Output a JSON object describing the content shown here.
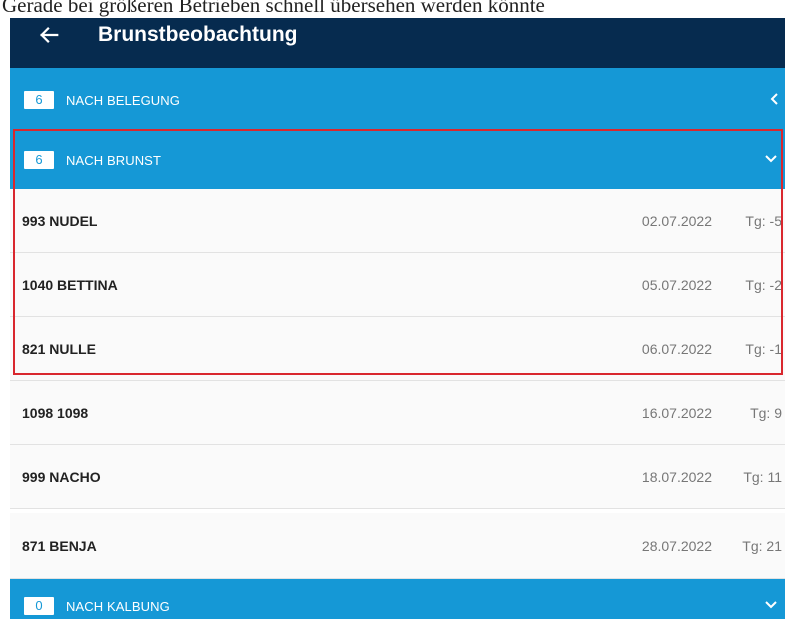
{
  "caption": "Gerade bei größeren Betrieben schnell übersehen werden könnte",
  "appbar": {
    "title": "Brunstbeobachtung",
    "back_icon": "arrow-left-icon"
  },
  "sections": [
    {
      "count": "6",
      "label": "NACH BELEGUNG",
      "chevron_icon": "chevron-left-icon"
    },
    {
      "count": "6",
      "label": "NACH BRUNST",
      "chevron_icon": "chevron-down-icon"
    },
    {
      "count": "0",
      "label": "NACH KALBUNG",
      "chevron_icon": "chevron-down-icon"
    }
  ],
  "rows": [
    {
      "name": "993 NUDEL",
      "date": "02.07.2022",
      "days": "Tg: -5"
    },
    {
      "name": "1040 BETTINA",
      "date": "05.07.2022",
      "days": "Tg: -2"
    },
    {
      "name": "821 NULLE",
      "date": "06.07.2022",
      "days": "Tg: -1"
    },
    {
      "name": "1098 1098",
      "date": "16.07.2022",
      "days": "Tg: 9"
    },
    {
      "name": "999 NACHO",
      "date": "18.07.2022",
      "days": "Tg: 11"
    },
    {
      "name": "871 BENJA",
      "date": "28.07.2022",
      "days": "Tg: 21"
    }
  ],
  "colors": {
    "appbar": "#062b4f",
    "section": "#1598d6",
    "highlight": "#d9272e"
  }
}
